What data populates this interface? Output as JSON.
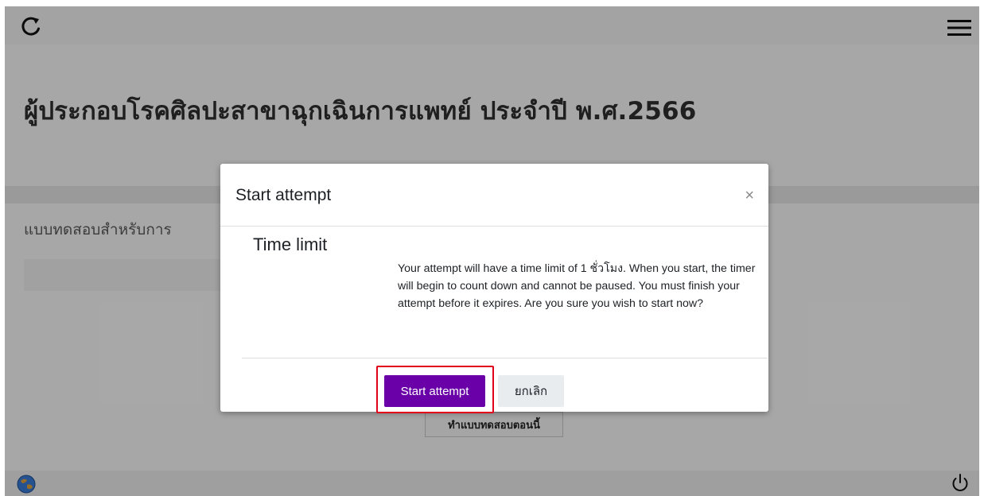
{
  "header": {
    "reload_icon": "reload-icon",
    "menu_icon": "hamburger-menu-icon"
  },
  "page": {
    "title": "ผู้ประกอบโรคศิลปะสาขาฉุกเฉินการแพทย์ ประจำปี พ.ศ.2566",
    "section_text": "แบบทดสอบสำหรับการ",
    "background_button": "ทำแบบทดสอบตอนนี้"
  },
  "footer": {
    "globe_icon": "globe-icon",
    "power_icon": "power-icon"
  },
  "modal": {
    "title": "Start attempt",
    "close": "×",
    "section_title": "Time limit",
    "message": "Your attempt will have a time limit of 1 ชั่วโมง. When you start, the timer will begin to count down and cannot be paused. You must finish your attempt before it expires. Are you sure you wish to start now?",
    "primary_button": "Start attempt",
    "secondary_button": "ยกเลิก"
  },
  "colors": {
    "primary": "#6900a8",
    "highlight": "#e3001b"
  }
}
